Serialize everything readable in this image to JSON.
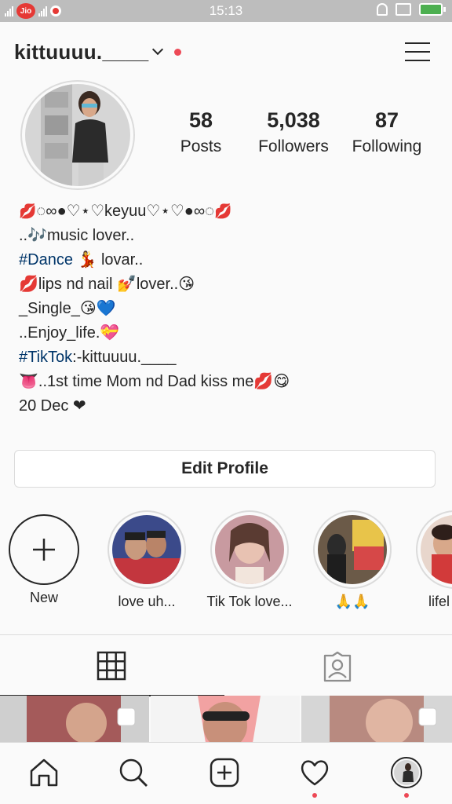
{
  "status_bar": {
    "carrier": "Jio",
    "time": "15:13"
  },
  "header": {
    "username": "kittuuuu.____"
  },
  "stats": [
    {
      "value": "58",
      "label": "Posts"
    },
    {
      "value": "5,038",
      "label": "Followers"
    },
    {
      "value": "87",
      "label": "Following"
    }
  ],
  "bio": {
    "line1": "◌∞●♡⋆♡keyuu♡⋆♡●∞◌",
    "line2": "..🎶music lover..",
    "line3_tag": "#Dance",
    "line3_rest": " 💃 lovar..",
    "line4": "💋lips nd nail 💅lover..😘",
    "line5": "_Single_😘💙",
    "line6": "..Enjoy_life.💝",
    "line7_tag": "#TikTok",
    "line7_rest": ":-kittuuuu.____",
    "line8": "👅..1st time Mom nd Dad kiss me💋😋",
    "line9": "20 Dec ❤"
  },
  "edit_profile_label": "Edit Profile",
  "highlights": [
    {
      "label": "New"
    },
    {
      "label": "love uh..."
    },
    {
      "label": "Tik Tok love..."
    },
    {
      "label": "🙏🙏"
    },
    {
      "label": "lifel"
    }
  ],
  "colors": {
    "link": "#003569",
    "notification": "#ed4956",
    "text": "#262626",
    "border": "#dbdbdb"
  },
  "icons": {
    "tabs": [
      "grid-icon",
      "tagged-icon"
    ],
    "nav": [
      "home-icon",
      "search-icon",
      "add-post-icon",
      "heart-icon",
      "profile-avatar"
    ]
  }
}
